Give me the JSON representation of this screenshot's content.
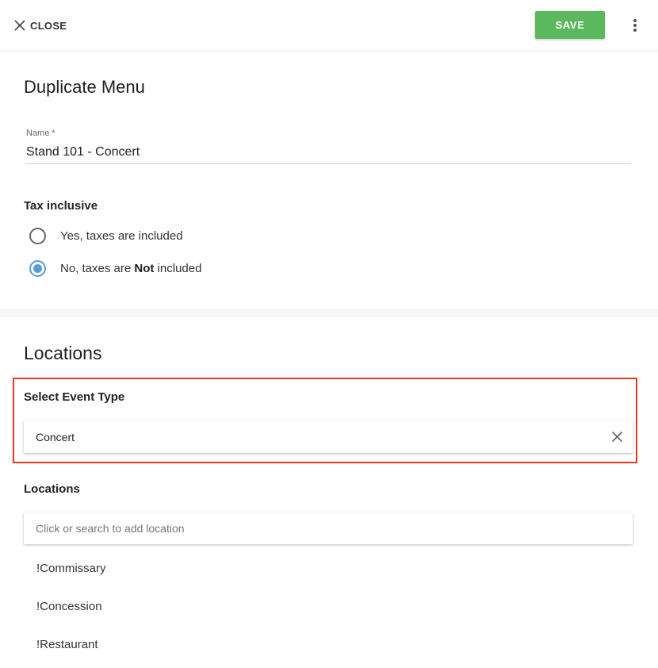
{
  "header": {
    "close_label": "CLOSE",
    "save_label": "SAVE",
    "more_icon": "more-vertical-icon",
    "close_icon": "close-icon"
  },
  "form": {
    "title": "Duplicate Menu",
    "name_label": "Name *",
    "name_value": "Stand 101 - Concert",
    "tax_label": "Tax inclusive",
    "tax_options": [
      {
        "label": "Yes, taxes are included",
        "selected": false
      },
      {
        "label_prefix": "No, taxes are ",
        "label_bold": "Not",
        "label_suffix": " included",
        "selected": true
      }
    ]
  },
  "locations": {
    "title": "Locations",
    "event_type_label": "Select Event Type",
    "event_type_value": "Concert",
    "locations_label": "Locations",
    "search_placeholder": "Click or search to add location",
    "items": [
      "!Commissary",
      "!Concession",
      "!Restaurant"
    ]
  },
  "colors": {
    "save_button": "#5cb85c",
    "radio_selected": "#5b9bd5",
    "highlight_border": "#e53a1c"
  }
}
